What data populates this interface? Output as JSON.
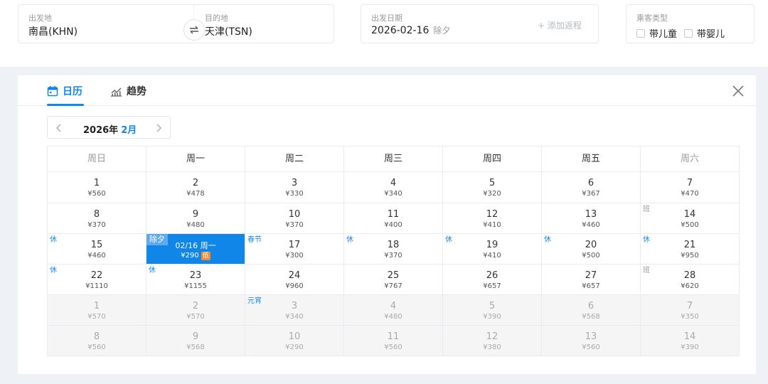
{
  "search": {
    "from": {
      "label": "出发地",
      "value": "南昌(KHN)"
    },
    "to": {
      "label": "目的地",
      "value": "天津(TSN)"
    },
    "date": {
      "label": "出发日期",
      "value": "2026-02-16",
      "holiday": "除夕",
      "add_return": "+ 添加返程"
    },
    "passenger": {
      "label": "乘客类型",
      "options": [
        "带儿童",
        "带婴儿"
      ]
    }
  },
  "tabs": [
    {
      "label": "日历",
      "icon": "calendar-icon",
      "active": true
    },
    {
      "label": "趋势",
      "icon": "trend-chart-icon",
      "active": false
    }
  ],
  "month_nav": {
    "year": "2026年",
    "month": "2月"
  },
  "weekdays": [
    "周日",
    "周一",
    "周二",
    "周三",
    "周四",
    "周五",
    "周六"
  ],
  "calendar": {
    "rows": [
      [
        {
          "day": "1",
          "price": "¥560"
        },
        {
          "day": "2",
          "price": "¥478"
        },
        {
          "day": "3",
          "price": "¥330"
        },
        {
          "day": "4",
          "price": "¥340"
        },
        {
          "day": "5",
          "price": "¥320"
        },
        {
          "day": "6",
          "price": "¥367"
        },
        {
          "day": "7",
          "price": "¥470"
        }
      ],
      [
        {
          "day": "8",
          "price": "¥370"
        },
        {
          "day": "9",
          "price": "¥480"
        },
        {
          "day": "10",
          "price": "¥370"
        },
        {
          "day": "11",
          "price": "¥400"
        },
        {
          "day": "12",
          "price": "¥410"
        },
        {
          "day": "13",
          "price": "¥460"
        },
        {
          "day": "14",
          "price": "¥500",
          "tag": "班"
        }
      ],
      [
        {
          "day": "15",
          "price": "¥460",
          "tag": "休"
        },
        {
          "day": "02/16 周一",
          "price": "¥290",
          "tag": "除夕",
          "selected": true,
          "low": "低"
        },
        {
          "day": "17",
          "price": "¥300",
          "tag": "春节"
        },
        {
          "day": "18",
          "price": "¥370",
          "tag": "休"
        },
        {
          "day": "19",
          "price": "¥410",
          "tag": "休"
        },
        {
          "day": "20",
          "price": "¥500",
          "tag": "休"
        },
        {
          "day": "21",
          "price": "¥950",
          "tag": "休"
        }
      ],
      [
        {
          "day": "22",
          "price": "¥1110",
          "tag": "休"
        },
        {
          "day": "23",
          "price": "¥1155",
          "tag": "休"
        },
        {
          "day": "24",
          "price": "¥960"
        },
        {
          "day": "25",
          "price": "¥767"
        },
        {
          "day": "26",
          "price": "¥657"
        },
        {
          "day": "27",
          "price": "¥657"
        },
        {
          "day": "28",
          "price": "¥620",
          "tag": "班"
        }
      ],
      [
        {
          "day": "1",
          "price": "¥570",
          "out": true
        },
        {
          "day": "2",
          "price": "¥570",
          "out": true
        },
        {
          "day": "3",
          "price": "¥340",
          "out": true,
          "tag": "元宵"
        },
        {
          "day": "4",
          "price": "¥480",
          "out": true
        },
        {
          "day": "5",
          "price": "¥390",
          "out": true
        },
        {
          "day": "6",
          "price": "¥568",
          "out": true
        },
        {
          "day": "7",
          "price": "¥350",
          "out": true
        }
      ],
      [
        {
          "day": "8",
          "price": "¥560",
          "out": true
        },
        {
          "day": "9",
          "price": "¥568",
          "out": true
        },
        {
          "day": "10",
          "price": "¥290",
          "out": true
        },
        {
          "day": "11",
          "price": "¥560",
          "out": true
        },
        {
          "day": "12",
          "price": "¥380",
          "out": true
        },
        {
          "day": "13",
          "price": "¥560",
          "out": true
        },
        {
          "day": "14",
          "price": "¥390",
          "out": true
        }
      ]
    ]
  },
  "colors": {
    "accent": "#0f86e8",
    "low_badge": "#f08a35",
    "holiday_tag": "#1a86e8"
  }
}
